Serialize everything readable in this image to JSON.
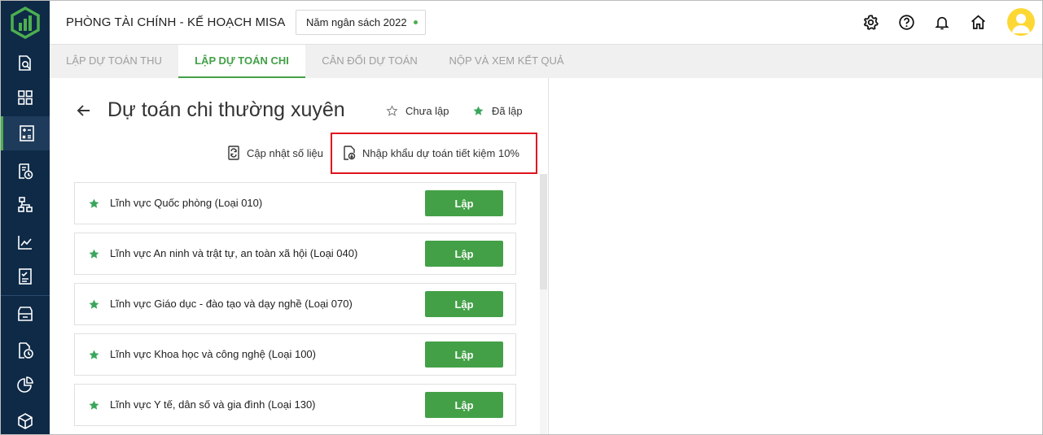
{
  "header": {
    "app_title": "PHÒNG TÀI CHÍNH - KẾ HOẠCH MISA",
    "budget_year": "Năm ngân sách 2022"
  },
  "tabs": [
    {
      "label": "LẬP DỰ TOÁN THU",
      "active": false
    },
    {
      "label": "LẬP DỰ TOÁN CHI",
      "active": true
    },
    {
      "label": "CÂN ĐỐI DỰ TOÁN",
      "active": false
    },
    {
      "label": "NỘP VÀ XEM KẾT QUẢ",
      "active": false
    }
  ],
  "page": {
    "title": "Dự toán chi thường xuyên",
    "legend_pending": "Chưa lập",
    "legend_done": "Đã lập"
  },
  "actions": {
    "update_data": "Cập nhật số liệu",
    "import_savings": "Nhập khẩu dự toán tiết kiệm 10%"
  },
  "fields": [
    {
      "label": "Lĩnh vực Quốc phòng (Loại 010)",
      "button": "Lập"
    },
    {
      "label": "Lĩnh vực An ninh và trật tự, an toàn xã hội (Loại 040)",
      "button": "Lập"
    },
    {
      "label": "Lĩnh vực Giáo dục - đào tạo và dạy nghề (Loại 070)",
      "button": "Lập"
    },
    {
      "label": "Lĩnh vực Khoa học và công nghệ (Loại 100)",
      "button": "Lập"
    },
    {
      "label": "Lĩnh vực Y tế, dân số và gia đình (Loại 130)",
      "button": "Lập"
    }
  ],
  "colors": {
    "sidebar": "#0e2a47",
    "accent": "#43a047",
    "highlight": "#e0141e",
    "avatar": "#fdd835"
  }
}
